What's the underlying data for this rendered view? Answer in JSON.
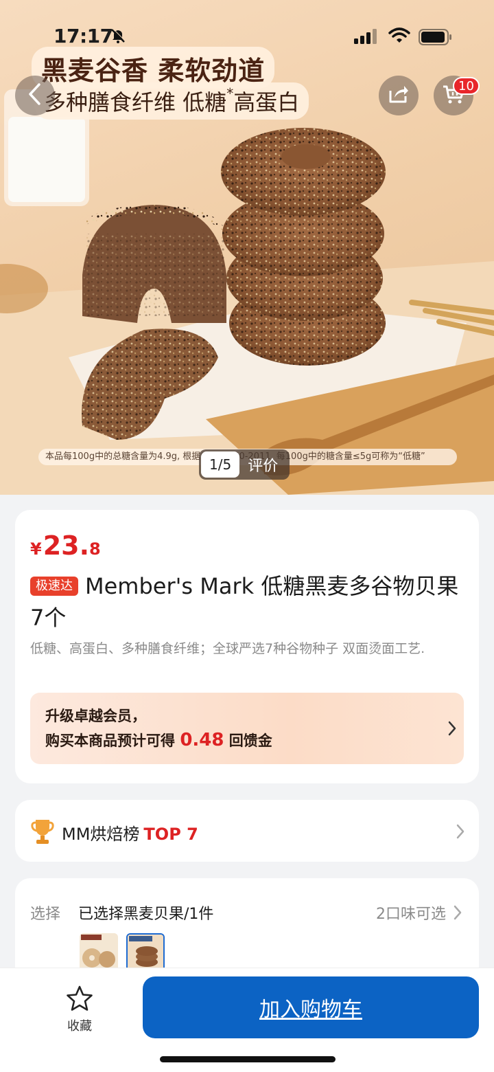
{
  "status_bar": {
    "time": "17:17"
  },
  "hero": {
    "headline": "黑麦谷香 柔软劲道",
    "subline_part1": "多种膳食纤维  低糖",
    "subline_asterisk": "*",
    "subline_part2": "高蛋白",
    "disclaimer": "本品每100g中的总糖含量为4.9g, 根据GB 28050-2011, 每100g中的糖含量≤5g可称为“低糖”",
    "pager_count": "1/5",
    "pager_review": "评价",
    "cart_badge": "10"
  },
  "product": {
    "price_symbol": "¥",
    "price_int": "23.",
    "price_dec": "8",
    "speed_tag": "极速达",
    "title": "Member's Mark 低糖黑麦多谷物贝果7个",
    "description": "低糖、高蛋白、多种膳食纤维；全球严选7种谷物种子 双面烫面工艺.",
    "promo_line1": "升级卓越会员，",
    "promo_line2_prefix": "购买本商品预计可得 ",
    "promo_amount": "0.48",
    "promo_line2_suffix": " 回馈金"
  },
  "ranking": {
    "label": "MM烘焙榜",
    "top": "TOP 7"
  },
  "selection": {
    "label": "选择",
    "value": "已选择黑麦贝果/1件",
    "flavors": "2口味可选"
  },
  "bottom_bar": {
    "favorite_label": "收藏",
    "add_to_cart_label": "加入购物车"
  },
  "colors": {
    "price_red": "#dd2223",
    "primary_blue": "#0c63c4",
    "badge_red": "#e8262b"
  },
  "icons": [
    "bell-slash-icon",
    "signal-icon",
    "wifi-icon",
    "battery-icon",
    "back-icon",
    "share-icon",
    "cart-icon",
    "chevron-right-icon",
    "trophy-icon",
    "star-icon"
  ]
}
